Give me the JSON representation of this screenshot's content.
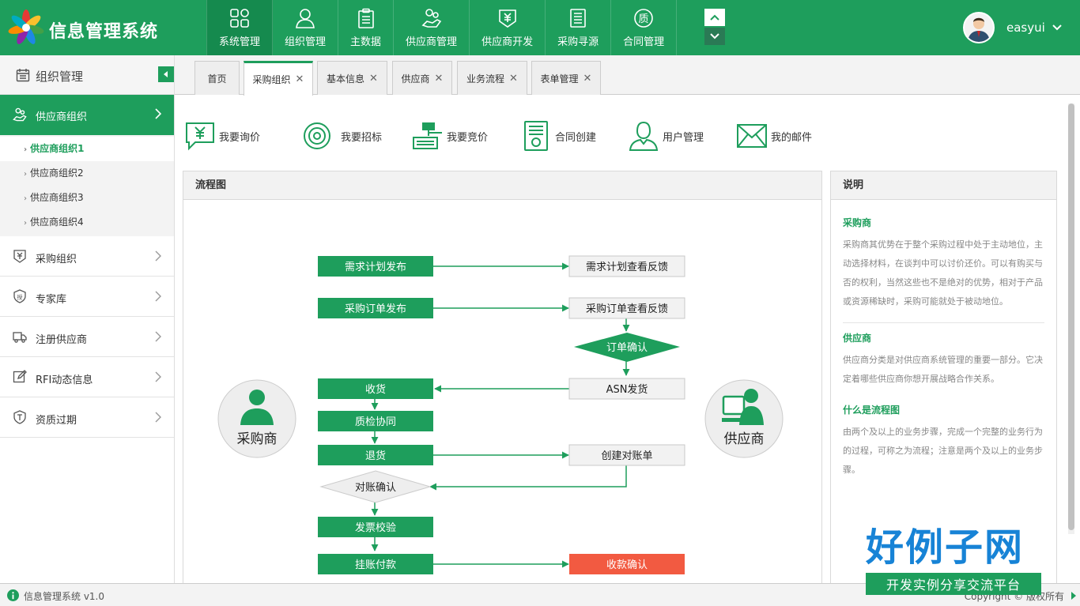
{
  "header": {
    "title": "信息管理系统",
    "nav": [
      {
        "label": "系统管理",
        "icon": "grid-icon",
        "active": true
      },
      {
        "label": "组织管理",
        "icon": "user-icon",
        "active": false
      },
      {
        "label": "主数据",
        "icon": "clipboard-icon",
        "active": false
      },
      {
        "label": "供应商管理",
        "icon": "supplier-icon",
        "active": false
      },
      {
        "label": "供应商开发",
        "icon": "yen-badge-icon",
        "active": false
      },
      {
        "label": "采购寻源",
        "icon": "document-icon",
        "active": false
      },
      {
        "label": "合同管理",
        "icon": "quality-icon",
        "active": false
      }
    ],
    "user": {
      "name": "easyui"
    }
  },
  "sidebar": {
    "title": "组织管理",
    "active_menu": "供应商组织",
    "submenu": [
      "供应商组织1",
      "供应商组织2",
      "供应商组织3",
      "供应商组织4"
    ],
    "menus": [
      {
        "label": "采购组织",
        "icon": "yen-doc-icon"
      },
      {
        "label": "专家库",
        "icon": "shield-icon"
      },
      {
        "label": "注册供应商",
        "icon": "truck-icon"
      },
      {
        "label": "RFI动态信息",
        "icon": "edit-icon"
      },
      {
        "label": "资质过期",
        "icon": "badge-icon"
      }
    ]
  },
  "tabs": [
    {
      "label": "首页",
      "closable": false
    },
    {
      "label": "采购组织",
      "closable": true,
      "active": true
    },
    {
      "label": "基本信息",
      "closable": true
    },
    {
      "label": "供应商",
      "closable": true
    },
    {
      "label": "业务流程",
      "closable": true
    },
    {
      "label": "表单管理",
      "closable": true
    }
  ],
  "quick_actions": [
    {
      "label": "我要询价",
      "icon": "yen-chat-icon"
    },
    {
      "label": "我要招标",
      "icon": "target-icon"
    },
    {
      "label": "我要竞价",
      "icon": "gavel-icon"
    },
    {
      "label": "合同创建",
      "icon": "contract-icon"
    },
    {
      "label": "用户管理",
      "icon": "person-outline-icon"
    },
    {
      "label": "我的邮件",
      "icon": "mail-icon"
    }
  ],
  "flow": {
    "title": "流程图",
    "left_actor": "采购商",
    "right_actor": "供应商",
    "nodes": {
      "demand_publish": "需求计划发布",
      "demand_feedback": "需求计划查看反馈",
      "order_publish": "采购订单发布",
      "order_feedback": "采购订单查看反馈",
      "order_confirm": "订单确认",
      "asn": "ASN发货",
      "receive": "收货",
      "qc": "质检协同",
      "return": "退货",
      "create_statement": "创建对账单",
      "statement_confirm": "对账确认",
      "invoice_check": "发票校验",
      "payment": "挂账付款",
      "receipt_confirm": "收款确认"
    }
  },
  "description": {
    "title": "说明",
    "sections": [
      {
        "heading": "采购商",
        "text": "采购商其优势在于整个采购过程中处于主动地位，主动选择材料，在谈判中可以讨价还价。可以有购买与否的权利，当然这些也不是绝对的优势，相对于产品或资源稀缺时，采购可能就处于被动地位。"
      },
      {
        "heading": "供应商",
        "text": "供应商分类是对供应商系统管理的重要一部分。它决定着哪些供应商你想开展战略合作关系。"
      },
      {
        "heading": "什么是流程图",
        "text": "由两个及以上的业务步骤，完成一个完整的业务行为的过程，可称之为流程；注意是两个及以上的业务步骤。"
      }
    ]
  },
  "footer": {
    "version": "信息管理系统 v1.0",
    "copyright": "Copyright © 版权所有"
  },
  "watermark": {
    "big": "好例子网",
    "small": "开发实例分享交流平台"
  },
  "colors": {
    "primary": "#1e9e5c",
    "primary_dark": "#158a4e",
    "alert": "#f25a41"
  }
}
